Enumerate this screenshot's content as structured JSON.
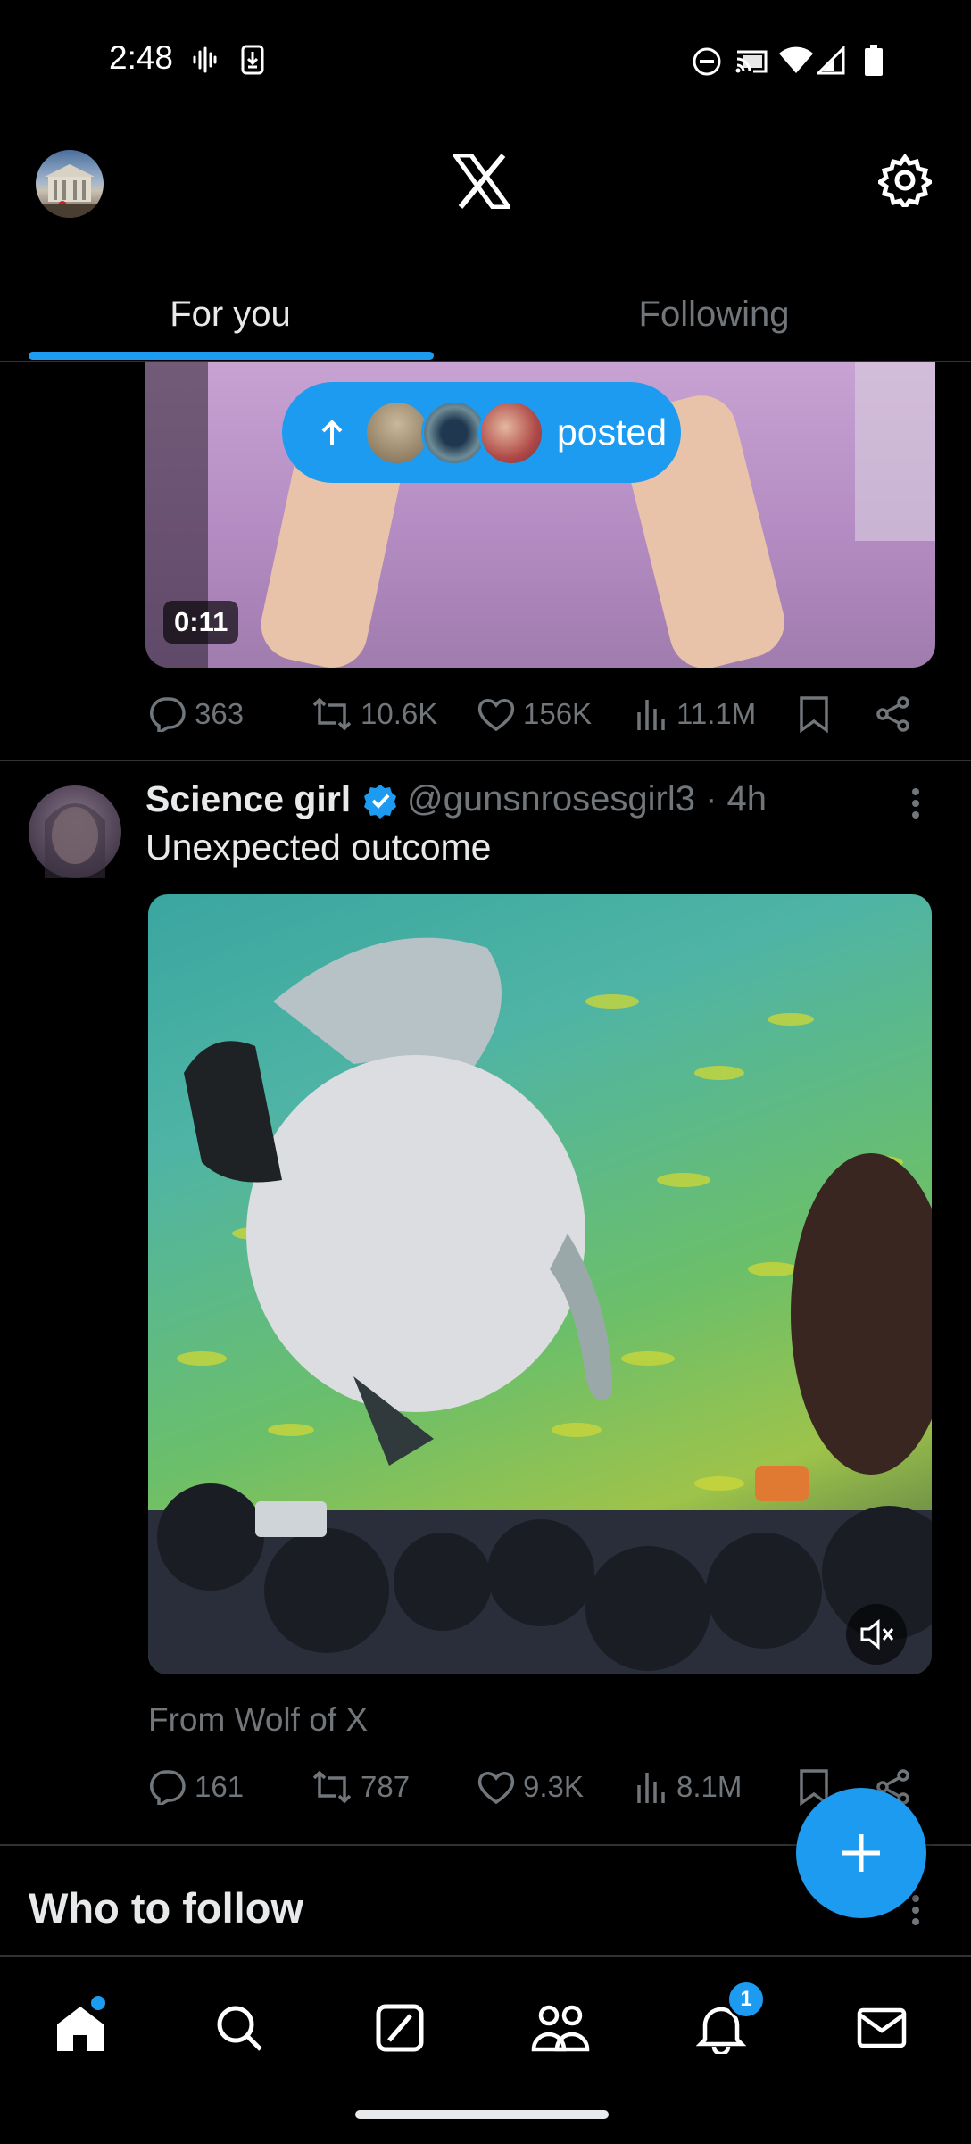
{
  "status_bar": {
    "time": "2:48",
    "left_icons": [
      "voicemail-waveform-icon",
      "download-icon"
    ],
    "right_icons": [
      "do-not-disturb-icon",
      "cast-icon",
      "wifi-icon",
      "signal-icon",
      "battery-icon"
    ]
  },
  "header": {
    "logo": "x-logo-icon",
    "settings_icon": "gear-icon"
  },
  "tabs": [
    {
      "label": "For you",
      "selected": true
    },
    {
      "label": "Following",
      "selected": false
    }
  ],
  "post_previous": {
    "video_duration": "0:11",
    "new_posts_pill": "posted",
    "actions": {
      "replies": "363",
      "reposts": "10.6K",
      "likes": "156K",
      "views": "11.1M"
    }
  },
  "post": {
    "author_name": "Science girl",
    "handle_time": "@gunsnrosesgirl3 · 4h",
    "text": "Unexpected outcome",
    "attribution": "From Wolf of X",
    "actions": {
      "replies": "161",
      "reposts": "787",
      "likes": "9.3K",
      "views": "8.1M"
    }
  },
  "who_to_follow": {
    "title": "Who to follow"
  },
  "bottom_nav": {
    "items": [
      "home-icon",
      "search-icon",
      "grok-icon",
      "communities-icon",
      "notifications-icon",
      "messages-icon"
    ],
    "notifications_badge": "1"
  },
  "colors": {
    "accent": "#1d9bf0",
    "background": "#000000",
    "text_primary": "#e7e9ea",
    "text_secondary": "#71767b"
  }
}
